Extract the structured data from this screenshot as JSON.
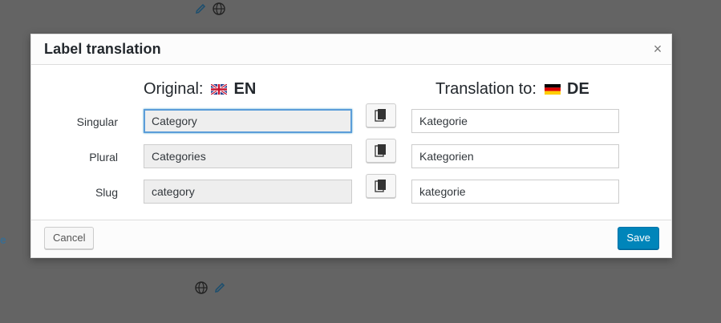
{
  "background": {
    "top_icons": [
      "pencil-icon",
      "globe-icon"
    ],
    "bottom_icons": [
      "globe-icon",
      "pencil-icon"
    ],
    "partial_text": "e"
  },
  "modal": {
    "title": "Label translation",
    "close_symbol": "×"
  },
  "columns": {
    "original_label": "Original:",
    "original_lang": "EN",
    "translation_label": "Translation to:",
    "translation_lang": "DE"
  },
  "rows": [
    {
      "label": "Singular",
      "original": "Category",
      "translation": "Kategorie"
    },
    {
      "label": "Plural",
      "original": "Categories",
      "translation": "Kategorien"
    },
    {
      "label": "Slug",
      "original": "category",
      "translation": "kategorie"
    }
  ],
  "footer": {
    "cancel_label": "Cancel",
    "save_label": "Save"
  },
  "colors": {
    "accent": "#0085ba",
    "focus": "#5b9dd9",
    "overlay": "#646464"
  }
}
